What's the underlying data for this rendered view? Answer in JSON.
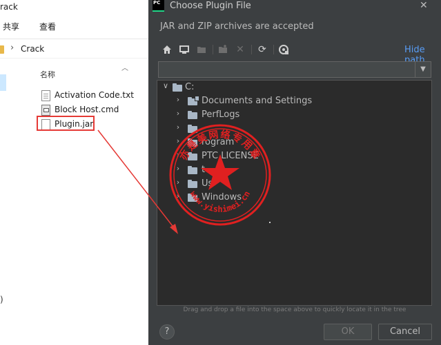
{
  "explorer": {
    "window_title_fragment": "rack",
    "ribbon": {
      "share": "共享",
      "view": "查看"
    },
    "breadcrumb": "Crack",
    "nav_fragment": ")",
    "column_name": "名称",
    "files": [
      {
        "name": "Activation Code.txt",
        "kind": "txt"
      },
      {
        "name": "Block Host.cmd",
        "kind": "cmd"
      },
      {
        "name": "Plugin.jar",
        "kind": "jar"
      }
    ]
  },
  "dialog": {
    "app_logo": "PC",
    "title": "Choose Plugin File",
    "description": "JAR and ZIP archives are accepted",
    "hide_path": "Hide path",
    "path_value": "",
    "toolbar_icons": [
      "home-icon",
      "desktop-icon",
      "project-folder-icon",
      "new-folder-icon",
      "delete-icon",
      "refresh-icon",
      "show-hidden-icon"
    ],
    "tree": {
      "root": "C:",
      "children": [
        "Documents and Settings",
        "PerfLogs",
        "Program Files",
        "Program Files (x86)",
        "PTC LICENSE",
        "temp",
        "Users",
        "Windows"
      ],
      "visible_labels": [
        "Documents and Settings",
        "PerfLogs",
        "",
        "rogram",
        "PTC LICENSE",
        "t",
        "Us",
        "Windows"
      ]
    },
    "drop_hint": "Drag and drop a file into the space above to quickly locate it in the tree",
    "help": "?",
    "ok": "OK",
    "cancel": "Cancel"
  },
  "overlay": {
    "highlight_color": "#e53935",
    "stamp_color": "#e02020",
    "stamp_top_text": "亦是美网络专用章",
    "stamp_bottom_text": "www.yishimei.cn"
  },
  "colors": {
    "dialog_bg": "#3c3f41",
    "tree_bg": "#2b2b2b",
    "link": "#589df6",
    "text": "#bbbbbb"
  }
}
